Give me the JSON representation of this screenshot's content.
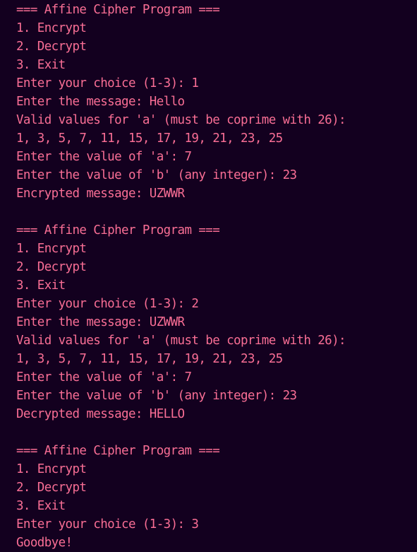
{
  "terminal": {
    "colors": {
      "background": "#13001f",
      "text": "#f96e95"
    },
    "lines": [
      "=== Affine Cipher Program ===",
      "1. Encrypt",
      "2. Decrypt",
      "3. Exit",
      "Enter your choice (1-3): 1",
      "Enter the message: Hello",
      "Valid values for 'a' (must be coprime with 26):",
      "1, 3, 5, 7, 11, 15, 17, 19, 21, 23, 25",
      "Enter the value of 'a': 7",
      "Enter the value of 'b' (any integer): 23",
      "Encrypted message: UZWWR",
      "",
      "=== Affine Cipher Program ===",
      "1. Encrypt",
      "2. Decrypt",
      "3. Exit",
      "Enter your choice (1-3): 2",
      "Enter the message: UZWWR",
      "Valid values for 'a' (must be coprime with 26):",
      "1, 3, 5, 7, 11, 15, 17, 19, 21, 23, 25",
      "Enter the value of 'a': 7",
      "Enter the value of 'b' (any integer): 23",
      "Decrypted message: HELLO",
      "",
      "=== Affine Cipher Program ===",
      "1. Encrypt",
      "2. Decrypt",
      "3. Exit",
      "Enter your choice (1-3): 3",
      "Goodbye!"
    ]
  }
}
